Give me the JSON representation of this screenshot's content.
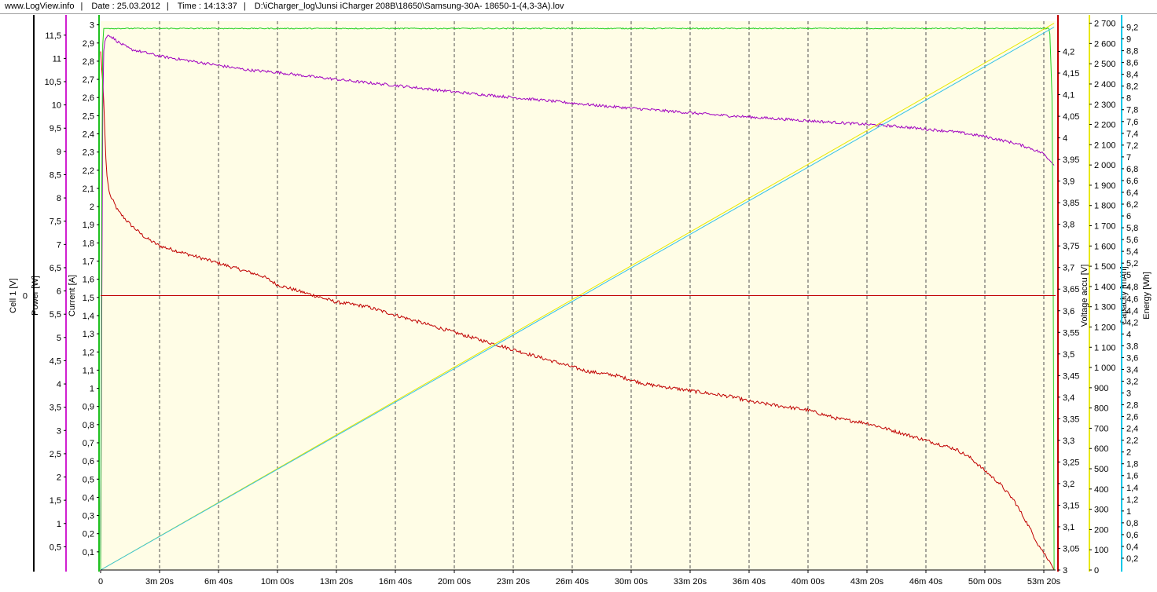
{
  "header": {
    "site": "www.LogView.info",
    "date": "Date : 25.03.2012",
    "time": "Time : 14:13:37",
    "path": "D:\\iCharger_log\\Junsi iCharger 208B\\18650\\Samsung-30A- 18650-1-(4,3-3A).lov"
  },
  "chart_data": {
    "type": "line",
    "x_unit": "s",
    "xlim": [
      0,
      3240
    ],
    "x_tick_labels": [
      "0",
      "3m 20s",
      "6m 40s",
      "10m 00s",
      "13m 20s",
      "16m 40s",
      "20m 00s",
      "23m 20s",
      "26m 40s",
      "30m 00s",
      "33m 20s",
      "36m 40s",
      "40m 00s",
      "43m 20s",
      "46m 40s",
      "50m 00s",
      "53m 20s"
    ],
    "x_tick_values": [
      0,
      200,
      400,
      600,
      800,
      1000,
      1200,
      1400,
      1600,
      1800,
      2000,
      2200,
      2400,
      2600,
      2800,
      3000,
      3200
    ],
    "grid": "vertical dashed",
    "background": "#fffde6",
    "axes": [
      {
        "id": "cell",
        "label": "Cell 1 [V]",
        "mid_label": "0",
        "color": "#000000",
        "side": "left",
        "ylim": [
          0,
          12
        ],
        "ticks": [],
        "tick_labels": []
      },
      {
        "id": "power",
        "label": "Power [W]",
        "color": "#d020d0",
        "side": "left",
        "ylim": [
          0,
          11.8
        ],
        "ticks": [
          0.5,
          1,
          1.5,
          2,
          2.5,
          3,
          3.5,
          4,
          4.5,
          5,
          5.5,
          6,
          6.5,
          7,
          7.5,
          8,
          8.5,
          9,
          9.5,
          10,
          10.5,
          11,
          11.5
        ],
        "tick_labels": [
          "0,5",
          "1",
          "1,5",
          "2",
          "2,5",
          "3",
          "3,5",
          "4",
          "4,5",
          "5",
          "5,5",
          "6",
          "6,5",
          "7",
          "7,5",
          "8",
          "8,5",
          "9",
          "9,5",
          "10",
          "10,5",
          "11",
          "11,5"
        ]
      },
      {
        "id": "current",
        "label": "Current [A]",
        "color": "#20c020",
        "side": "left",
        "ylim": [
          0,
          3.02
        ],
        "ticks": [
          0.1,
          0.2,
          0.3,
          0.4,
          0.5,
          0.6,
          0.7,
          0.8,
          0.9,
          1,
          1.1,
          1.2,
          1.3,
          1.4,
          1.5,
          1.6,
          1.7,
          1.8,
          1.9,
          2,
          2.1,
          2.2,
          2.3,
          2.4,
          2.5,
          2.6,
          2.7,
          2.8,
          2.9,
          3
        ],
        "tick_labels": [
          "0,1",
          "0,2",
          "0,3",
          "0,4",
          "0,5",
          "0,6",
          "0,7",
          "0,8",
          "0,9",
          "1",
          "1,1",
          "1,2",
          "1,3",
          "1,4",
          "1,5",
          "1,6",
          "1,7",
          "1,8",
          "1,9",
          "2",
          "2,1",
          "2,2",
          "2,3",
          "2,4",
          "2,5",
          "2,6",
          "2,7",
          "2,8",
          "2,9",
          "3"
        ]
      },
      {
        "id": "voltage",
        "label": "Voltage accu [V]",
        "color": "#c00000",
        "side": "right",
        "ylim": [
          3,
          4.27
        ],
        "ticks": [
          3,
          3.05,
          3.1,
          3.15,
          3.2,
          3.25,
          3.3,
          3.35,
          3.4,
          3.45,
          3.5,
          3.55,
          3.6,
          3.65,
          3.7,
          3.75,
          3.8,
          3.85,
          3.9,
          3.95,
          4,
          4.05,
          4.1,
          4.15,
          4.2
        ],
        "tick_labels": [
          "3",
          "3,05",
          "3,1",
          "3,15",
          "3,2",
          "3,25",
          "3,3",
          "3,35",
          "3,4",
          "3,45",
          "3,5",
          "3,55",
          "3,6",
          "3,65",
          "3,7",
          "3,75",
          "3,8",
          "3,85",
          "3,9",
          "3,95",
          "4",
          "4,05",
          "4,1",
          "4,15",
          "4,2"
        ]
      },
      {
        "id": "capacity",
        "label": "Capacity [mAh]",
        "color": "#e8e800",
        "side": "right",
        "ylim": [
          0,
          2710
        ],
        "ticks": [
          0,
          100,
          200,
          300,
          400,
          500,
          600,
          700,
          800,
          900,
          1000,
          1100,
          1200,
          1300,
          1400,
          1500,
          1600,
          1700,
          1800,
          1900,
          2000,
          2100,
          2200,
          2300,
          2400,
          2500,
          2600,
          2700
        ],
        "tick_labels": [
          "0",
          "100",
          "200",
          "300",
          "400",
          "500",
          "600",
          "700",
          "800",
          "900",
          "1 000",
          "1 100",
          "1 200",
          "1 300",
          "1 400",
          "1 500",
          "1 600",
          "1 700",
          "1 800",
          "1 900",
          "2 000",
          "2 100",
          "2 200",
          "2 300",
          "2 400",
          "2 500",
          "2 600",
          "2 700"
        ]
      },
      {
        "id": "energy",
        "label": "Energy [Wh]",
        "color": "#00c8e8",
        "side": "right",
        "ylim": [
          0,
          9.3
        ],
        "ticks": [
          0.2,
          0.4,
          0.6,
          0.8,
          1,
          1.2,
          1.4,
          1.6,
          1.8,
          2,
          2.2,
          2.4,
          2.6,
          2.8,
          3,
          3.2,
          3.4,
          3.6,
          3.8,
          4,
          4.2,
          4.4,
          4.6,
          4.8,
          5,
          5.2,
          5.4,
          5.6,
          5.8,
          6,
          6.2,
          6.4,
          6.6,
          6.8,
          7,
          7.2,
          7.4,
          7.6,
          7.8,
          8,
          8.2,
          8.4,
          8.6,
          8.8,
          9,
          9.2
        ],
        "tick_labels": [
          "0,2",
          "0,4",
          "0,6",
          "0,8",
          "1",
          "1,2",
          "1,4",
          "1,6",
          "1,8",
          "2",
          "2,2",
          "2,4",
          "2,6",
          "2,8",
          "3",
          "3,2",
          "3,4",
          "3,6",
          "3,8",
          "4",
          "4,2",
          "4,4",
          "4,6",
          "4,8",
          "5",
          "5,2",
          "5,4",
          "5,6",
          "5,8",
          "6",
          "6,2",
          "6,4",
          "6,6",
          "6,8",
          "7",
          "7,2",
          "7,4",
          "7,6",
          "7,8",
          "8",
          "8,2",
          "8,4",
          "8,6",
          "8,8",
          "9",
          "9,2"
        ]
      }
    ],
    "series": [
      {
        "axis": "voltage",
        "color": "#c00000",
        "noise": 0.004,
        "x": [
          0,
          5,
          10,
          15,
          20,
          30,
          45,
          60,
          100,
          150,
          200,
          250,
          300,
          350,
          400,
          450,
          500,
          550,
          600,
          650,
          700,
          750,
          800,
          850,
          900,
          950,
          1000,
          1050,
          1100,
          1150,
          1200,
          1250,
          1300,
          1350,
          1400,
          1450,
          1500,
          1550,
          1600,
          1650,
          1700,
          1750,
          1800,
          1850,
          1900,
          1950,
          2000,
          2050,
          2100,
          2150,
          2200,
          2250,
          2300,
          2350,
          2400,
          2450,
          2500,
          2550,
          2600,
          2650,
          2700,
          2750,
          2800,
          2850,
          2900,
          2950,
          3000,
          3050,
          3100,
          3150,
          3180,
          3200,
          3220,
          3235
        ],
        "y": [
          4.2,
          4.15,
          4.1,
          4.0,
          3.92,
          3.87,
          3.85,
          3.83,
          3.8,
          3.77,
          3.75,
          3.74,
          3.73,
          3.72,
          3.71,
          3.7,
          3.69,
          3.68,
          3.66,
          3.65,
          3.64,
          3.63,
          3.62,
          3.615,
          3.61,
          3.6,
          3.59,
          3.58,
          3.57,
          3.56,
          3.55,
          3.54,
          3.53,
          3.52,
          3.51,
          3.5,
          3.49,
          3.48,
          3.47,
          3.46,
          3.455,
          3.45,
          3.44,
          3.43,
          3.425,
          3.42,
          3.415,
          3.41,
          3.405,
          3.4,
          3.39,
          3.385,
          3.38,
          3.375,
          3.37,
          3.36,
          3.35,
          3.345,
          3.34,
          3.33,
          3.32,
          3.31,
          3.3,
          3.29,
          3.28,
          3.26,
          3.23,
          3.2,
          3.16,
          3.1,
          3.06,
          3.04,
          3.02,
          3.0
        ]
      },
      {
        "axis": "power",
        "color": "#a000c0",
        "noise": 0.03,
        "x": [
          0,
          8,
          15,
          25,
          40,
          60,
          100,
          200,
          300,
          400,
          500,
          600,
          700,
          800,
          900,
          1000,
          1100,
          1200,
          1300,
          1400,
          1500,
          1600,
          1700,
          1800,
          1900,
          2000,
          2100,
          2200,
          2300,
          2400,
          2500,
          2600,
          2700,
          2800,
          2900,
          3000,
          3100,
          3150,
          3200,
          3235
        ],
        "y": [
          0,
          11.0,
          11.4,
          11.5,
          11.45,
          11.35,
          11.2,
          11.05,
          10.95,
          10.85,
          10.75,
          10.7,
          10.62,
          10.55,
          10.48,
          10.42,
          10.35,
          10.28,
          10.22,
          10.16,
          10.1,
          10.04,
          9.98,
          9.93,
          9.88,
          9.83,
          9.78,
          9.74,
          9.7,
          9.66,
          9.62,
          9.58,
          9.54,
          9.48,
          9.42,
          9.32,
          9.18,
          9.08,
          8.95,
          8.7
        ]
      },
      {
        "axis": "current",
        "color": "#20d020",
        "noise": 0.003,
        "x": [
          0,
          1,
          2,
          4,
          6,
          8,
          10,
          3200,
          3220,
          3230,
          3235
        ],
        "y": [
          0,
          0.2,
          1.0,
          2.2,
          2.8,
          2.95,
          2.98,
          2.98,
          2.98,
          2.5,
          0
        ]
      },
      {
        "axis": "capacity",
        "color": "#e8e800",
        "noise": 0,
        "x": [
          0,
          3235
        ],
        "y": [
          0,
          2700
        ]
      },
      {
        "axis": "energy",
        "color": "#30c0e8",
        "noise": 0,
        "x": [
          0,
          3235
        ],
        "y": [
          0,
          9.2
        ]
      },
      {
        "axis": "cell",
        "color": "#c00000",
        "noise": 0,
        "x": [
          0,
          3240
        ],
        "y": [
          6,
          6
        ]
      }
    ]
  }
}
